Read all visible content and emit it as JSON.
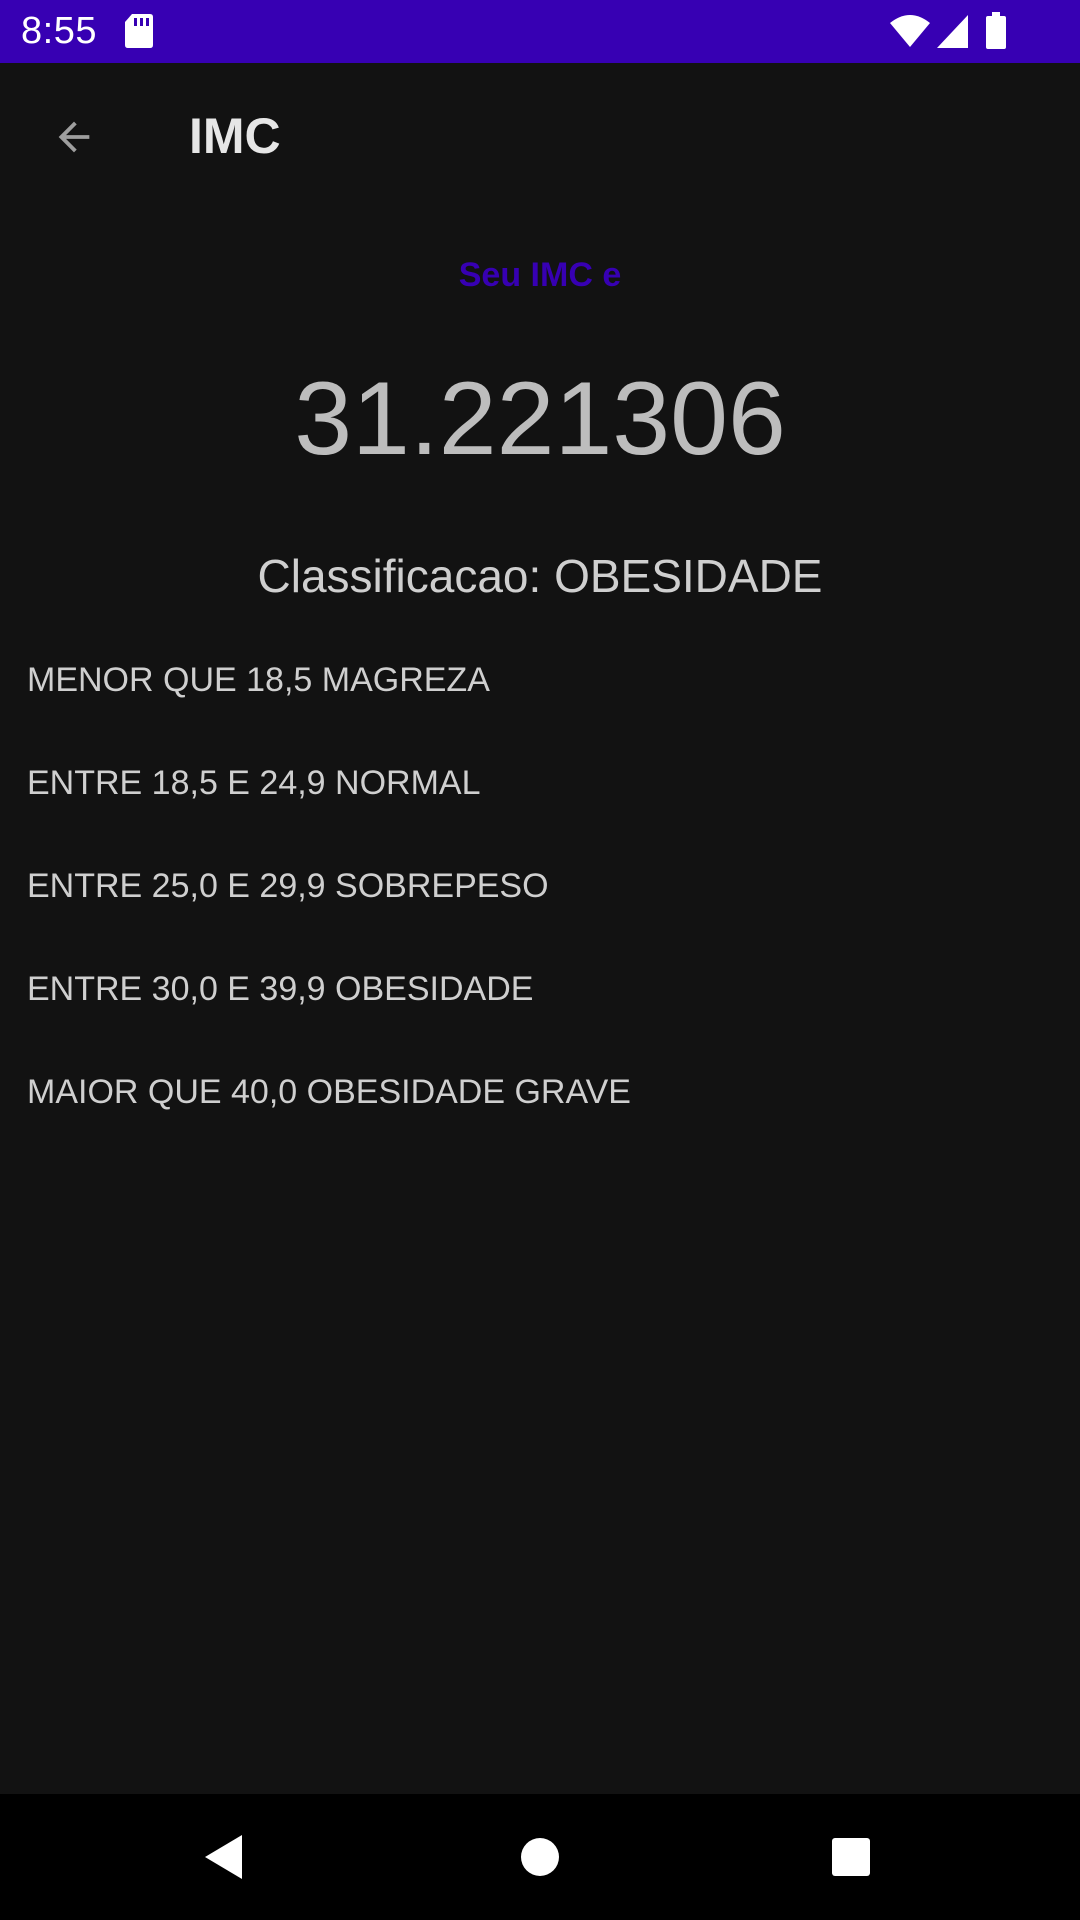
{
  "status_bar": {
    "time": "8:55",
    "background": "#3700b3",
    "icons": [
      "sd-card-icon",
      "wifi-icon",
      "cell-signal-icon",
      "battery-icon"
    ]
  },
  "app_bar": {
    "title": "IMC",
    "back_icon": "arrow-back-icon"
  },
  "result": {
    "label": "Seu IMC e",
    "label_color": "#3700b3",
    "value": "31.221306",
    "classification_prefix": "Classificacao: ",
    "classification_value": "OBESIDADE"
  },
  "ranges": [
    "MENOR QUE 18,5 MAGREZA",
    "ENTRE 18,5 E 24,9 NORMAL",
    "ENTRE 25,0 E 29,9 SOBREPESO",
    "ENTRE 30,0 E 39,9 OBESIDADE",
    "MAIOR QUE 40,0 OBESIDADE GRAVE"
  ],
  "nav_bar": {
    "icons": [
      "nav-back-icon",
      "nav-home-icon",
      "nav-recents-icon"
    ]
  }
}
